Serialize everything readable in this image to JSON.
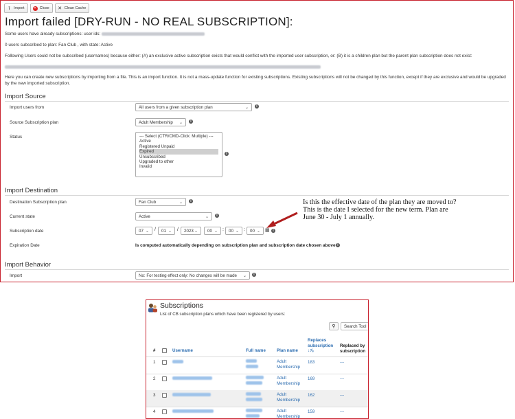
{
  "toolbar": {
    "import_label": "Import",
    "close_label": "Close",
    "clean_cache_label": "Clean Cache"
  },
  "page_title": "Import failed [DRY-RUN - NO REAL SUBSCRIPTION]:",
  "messages": {
    "already_subscribed": "Some users have already subscriptions: user ids:",
    "zero_subscribed": "0 users subscribed to plan: Fan Club , with state: Active",
    "not_subscribed": "Following Users could not be subscribed (usernames) because either: (A) an exclusive active subscription exists that would conflict with the imported user subscription, or: (B) it is a children plan but the parent plan subscription does not exist:",
    "intro": "Here you can create new subscriptions by importing from a file. This is an import function. It is not a mass-update function for existing subscriptions. Existing subscriptions will not be changed by this function, except if they are exclusive and would be upgraded by the new imported subscription."
  },
  "import_source": {
    "title": "Import Source",
    "import_users_from_label": "Import users from",
    "import_users_from_value": "All users from a given subscription plan",
    "source_plan_label": "Source Subscription plan",
    "source_plan_value": "Adult Membership",
    "status_label": "Status",
    "status_options": [
      "--- Select (CTR/CMD-Click: Multiple) ---",
      "Active",
      "Registered Unpaid",
      "Expired",
      "Unsubscribed",
      "Upgraded to other",
      "Invalid"
    ],
    "status_selected": "Expired"
  },
  "import_destination": {
    "title": "Import Destination",
    "dest_plan_label": "Destination Subscription plan",
    "dest_plan_value": "Fan Club",
    "current_state_label": "Current state",
    "current_state_value": "Active",
    "sub_date_label": "Subscription date",
    "sub_date": {
      "month": "07",
      "day": "01",
      "year": "2023",
      "hour": "00",
      "minute": "00",
      "second": "00",
      "date_sep": "/",
      "time_sep": ":"
    },
    "expiration_label": "Expiration Date",
    "expiration_text": "Is computed automatically depending on subscription plan and subscription date chosen above"
  },
  "import_behavior": {
    "title": "Import Behavior",
    "import_label": "Import",
    "import_value": "No: For testing effect only: No changes will be made"
  },
  "annotation": {
    "lines": [
      "Is this the effective date of the plan they are moved to?",
      "This is the date I selected for the new term.  Plan are",
      "June 30 - July 1 annually."
    ],
    "color": "#b01e1e"
  },
  "subscriptions": {
    "title": "Subscriptions",
    "subtitle": "List of CB subscription plans which have been registered by users:",
    "search_placeholder": "Search Tool",
    "columns": {
      "num": "#",
      "username": "Username",
      "fullname": "Full name",
      "plan": "Plan name",
      "replaces_1": "Replaces",
      "replaces_2": "subscription",
      "replaces_sort": "↓⅞",
      "replaced_1": "Replaced by",
      "replaced_2": "subscription"
    },
    "rows": [
      {
        "num": "1",
        "plan_1": "Adult",
        "plan_2": "Membership",
        "replaces": "183",
        "replaced": "---"
      },
      {
        "num": "2",
        "plan_1": "Adult",
        "plan_2": "Membership",
        "replaces": "169",
        "replaced": "---"
      },
      {
        "num": "3",
        "plan_1": "Adult",
        "plan_2": "Membership",
        "replaces": "162",
        "replaced": "---"
      },
      {
        "num": "4",
        "plan_1": "Adult",
        "plan_2": "Membership",
        "replaces": "159",
        "replaced": "---"
      }
    ]
  },
  "colors": {
    "border_red": "#c8202c",
    "link_blue": "#2b6cb0",
    "arrow": "#b01e1e"
  }
}
